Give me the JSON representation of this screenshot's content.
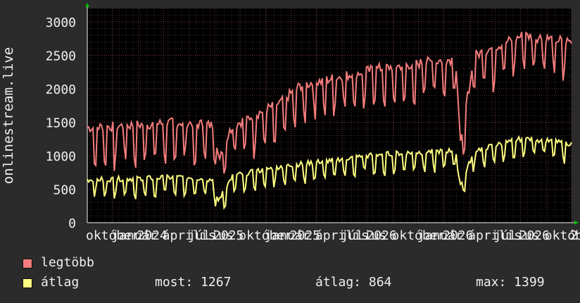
{
  "chart_data": {
    "type": "line",
    "ylabel": "onlinestream.live",
    "ylim": [
      0,
      3200
    ],
    "y_ticks": [
      0,
      500,
      1000,
      1500,
      2000,
      2500,
      3000
    ],
    "x_tick_labels": [
      "október",
      "január",
      "2024",
      "április",
      "július",
      "2025",
      "október",
      "január",
      "2025",
      "április",
      "július",
      "2026",
      "október",
      "január",
      "2026",
      "április",
      "július",
      "2026",
      "október",
      "2"
    ],
    "grid": true,
    "series": [
      {
        "name": "legtöbb",
        "color": "#f47c7c",
        "trend": [
          {
            "x": 0.0,
            "y": 1420
          },
          {
            "x": 0.2,
            "y": 1500
          },
          {
            "x": 0.26,
            "y": 1450
          },
          {
            "x": 0.27,
            "y": 950
          },
          {
            "x": 0.3,
            "y": 1450
          },
          {
            "x": 0.4,
            "y": 1800
          },
          {
            "x": 0.44,
            "y": 2050
          },
          {
            "x": 0.6,
            "y": 2300
          },
          {
            "x": 0.76,
            "y": 2450
          },
          {
            "x": 0.77,
            "y": 1250
          },
          {
            "x": 0.8,
            "y": 2500
          },
          {
            "x": 0.9,
            "y": 2800
          },
          {
            "x": 1.0,
            "y": 2700
          }
        ]
      },
      {
        "name": "átlag",
        "color": "#ffff80",
        "trend": [
          {
            "x": 0.0,
            "y": 640
          },
          {
            "x": 0.2,
            "y": 680
          },
          {
            "x": 0.26,
            "y": 640
          },
          {
            "x": 0.27,
            "y": 320
          },
          {
            "x": 0.3,
            "y": 700
          },
          {
            "x": 0.4,
            "y": 840
          },
          {
            "x": 0.6,
            "y": 1020
          },
          {
            "x": 0.76,
            "y": 1080
          },
          {
            "x": 0.77,
            "y": 560
          },
          {
            "x": 0.8,
            "y": 1080
          },
          {
            "x": 0.9,
            "y": 1260
          },
          {
            "x": 1.0,
            "y": 1180
          }
        ]
      }
    ],
    "legend": {
      "items": [
        {
          "label": "legtöbb",
          "color": "#f47c7c"
        },
        {
          "label": "átlag",
          "color": "#ffff80"
        }
      ],
      "stats": {
        "most": "most: 1267",
        "atlag": "átlag: 864",
        "max": "max: 1399"
      }
    }
  }
}
